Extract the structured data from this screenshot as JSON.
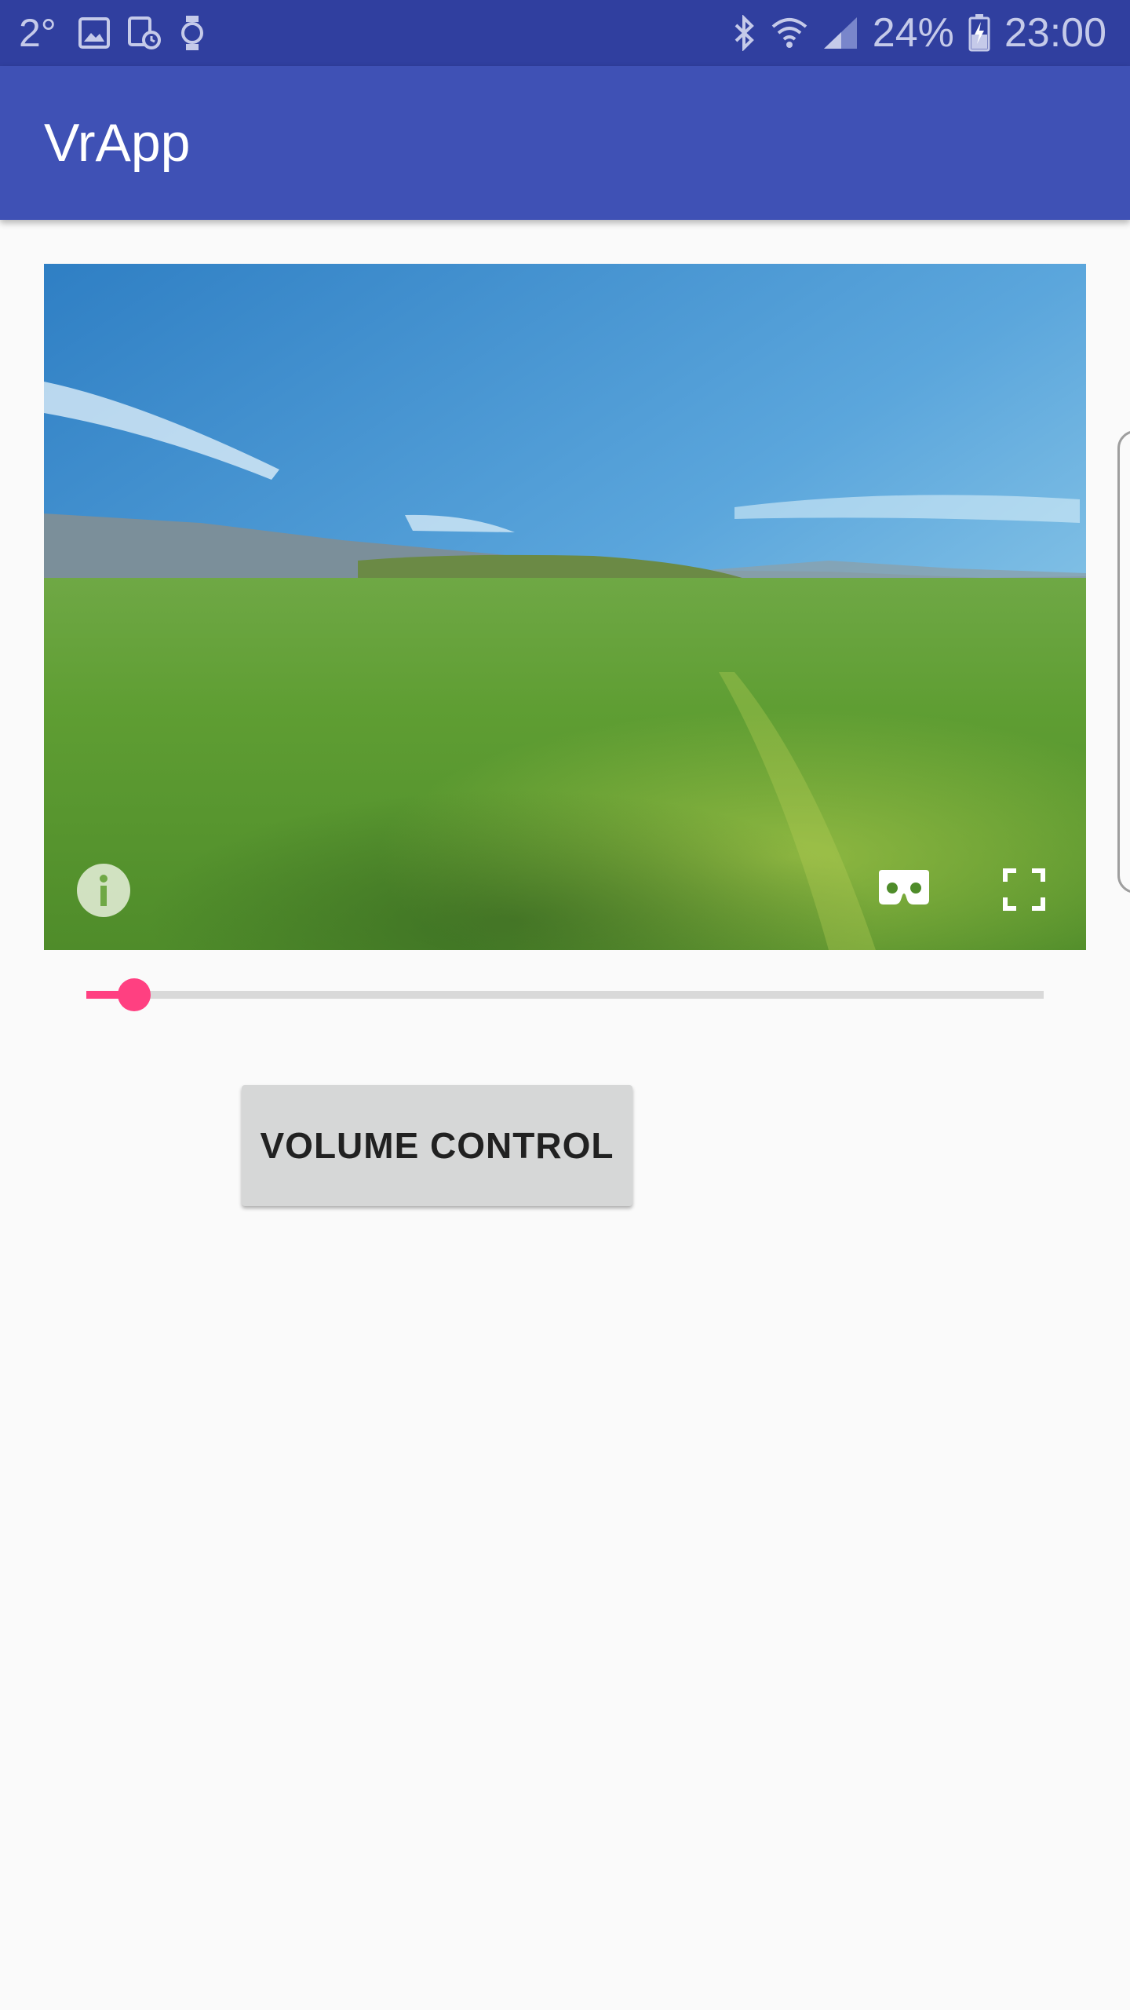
{
  "status_bar": {
    "temperature": "2°",
    "battery": "24%",
    "time": "23:00",
    "left_icons": [
      "image-icon",
      "screenshot-icon",
      "watch-icon"
    ],
    "right_icons": [
      "bluetooth-icon",
      "wifi-icon",
      "signal-icon",
      "battery-charging-icon"
    ],
    "background_color": "#303f9f",
    "text_color": "#c5cae9"
  },
  "app_bar": {
    "title": "VrApp",
    "background_color": "#3f51b5"
  },
  "vr_view": {
    "content": "360 panorama",
    "buttons": [
      "info-icon",
      "cardboard-icon",
      "fullscreen-icon"
    ]
  },
  "seekbar": {
    "progress_percent": 5,
    "accent_color": "#ff4081"
  },
  "volume_control": {
    "label": "VOLUME CONTROL"
  }
}
